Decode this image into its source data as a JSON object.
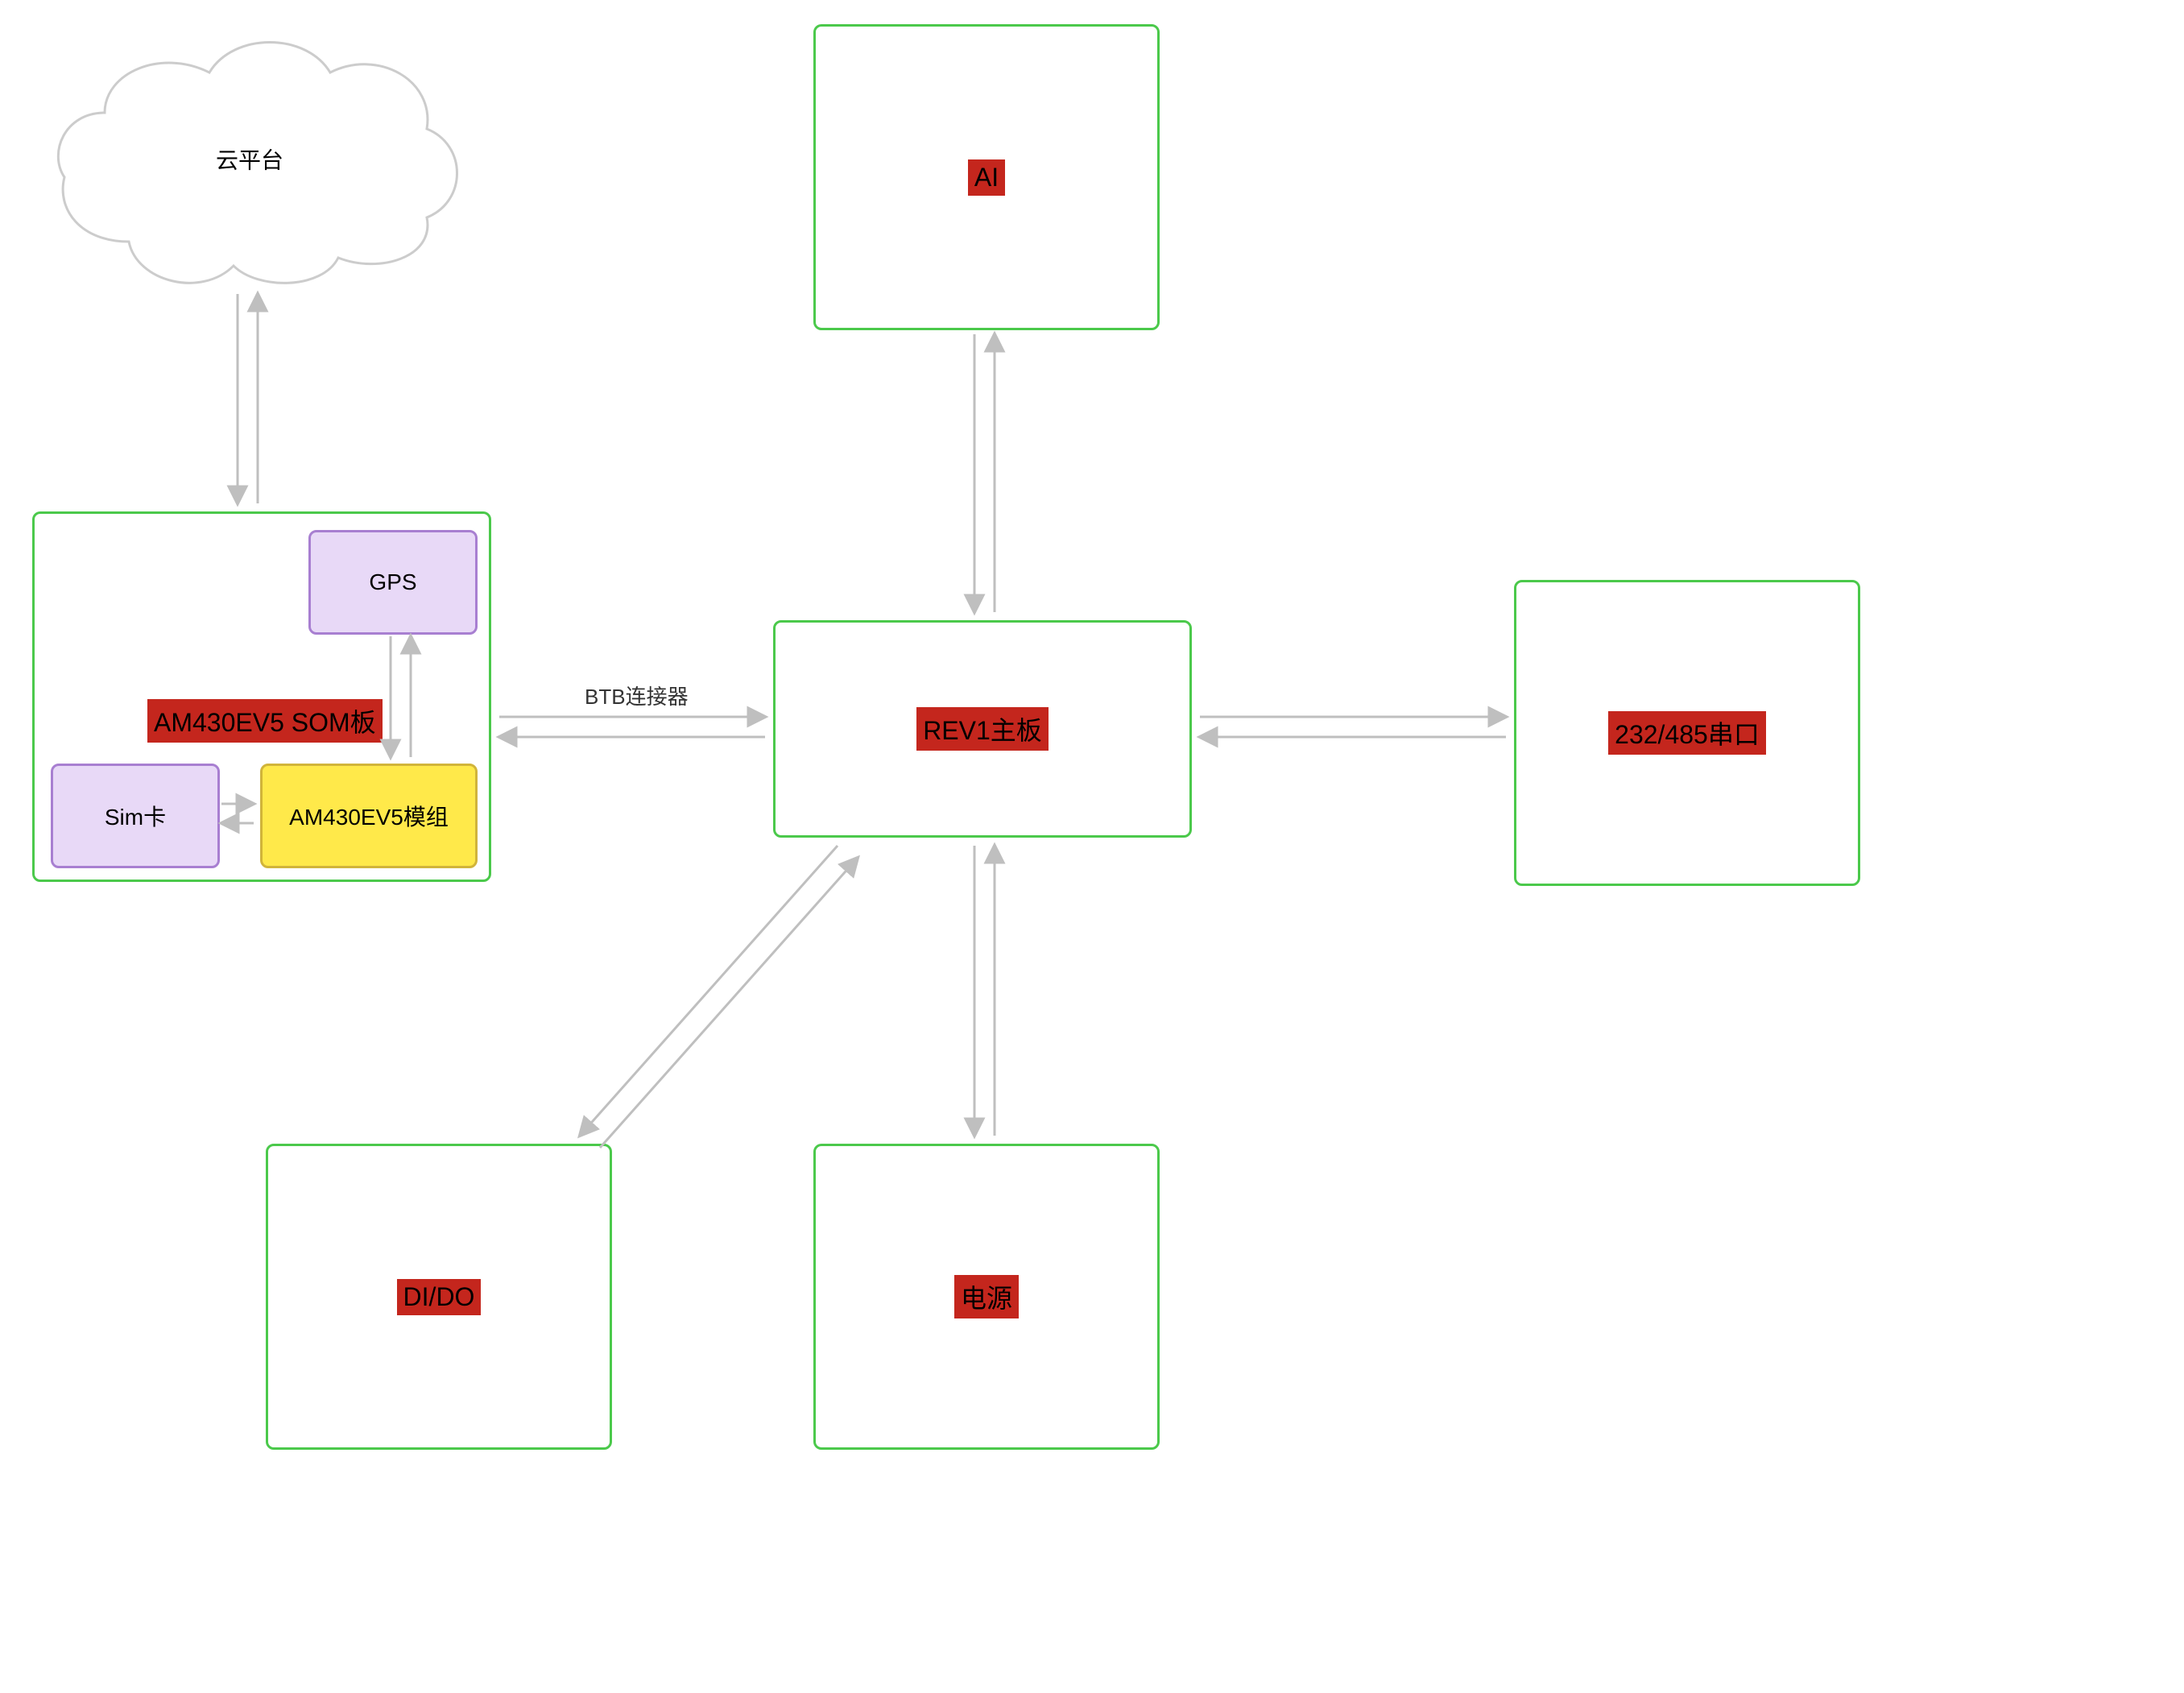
{
  "nodes": {
    "cloud": {
      "label": "云平台"
    },
    "som_board": {
      "label": "AM430EV5 SOM板"
    },
    "gps": {
      "label": "GPS"
    },
    "sim": {
      "label": "Sim卡"
    },
    "module": {
      "label": "AM430EV5模组"
    },
    "ai": {
      "label": "AI"
    },
    "rev1": {
      "label": "REV1主板"
    },
    "serial": {
      "label": "232/485串口"
    },
    "dido": {
      "label": "DI/DO"
    },
    "power": {
      "label": "电源"
    }
  },
  "edges": {
    "btb": {
      "label": "BTB连接器"
    }
  },
  "colors": {
    "green": "#4bc94b",
    "purple": "#a87fd1",
    "purpleFill": "#e8d9f7",
    "yellow": "#ffe94a",
    "yellowStroke": "#d1b43a",
    "highlight": "#c4261d",
    "arrow": "#bfbfbf",
    "cloudStroke": "#cccccc"
  }
}
